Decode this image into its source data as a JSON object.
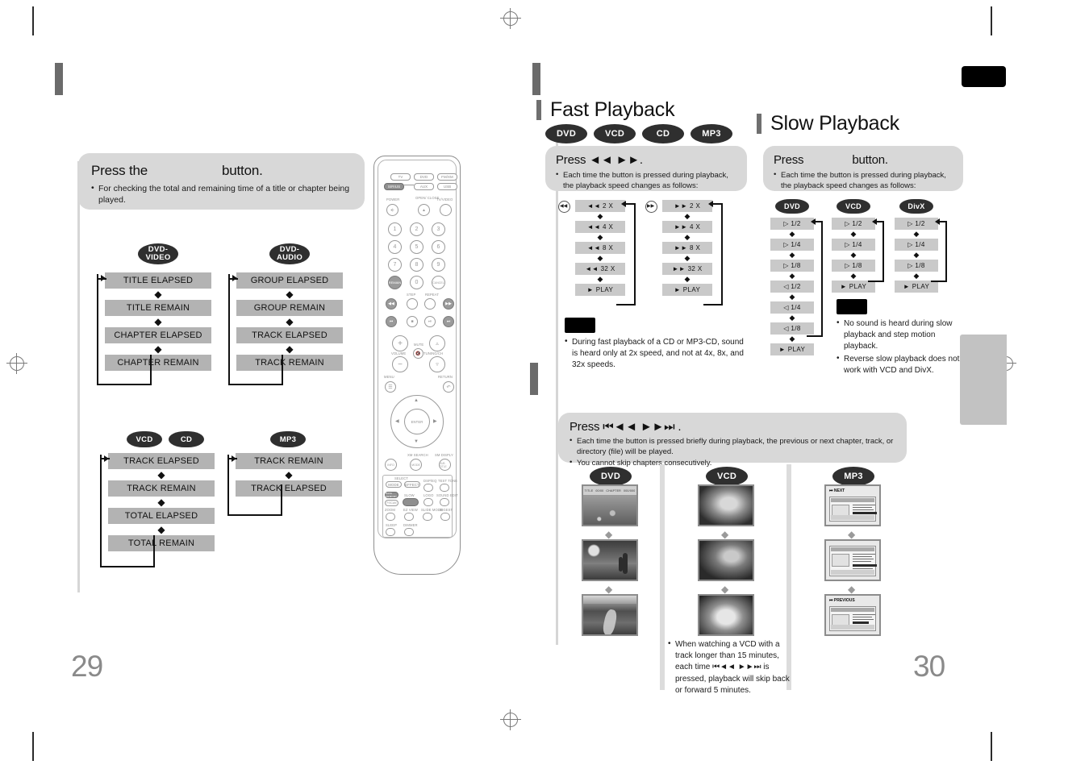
{
  "spread": {
    "left_page_number": "29",
    "right_page_number": "30"
  },
  "left_page": {
    "instruction_panel": {
      "press_prefix": "Press the",
      "press_suffix": "button.",
      "bullets": [
        "For checking the total and remaining time of a title or chapter being played."
      ]
    },
    "flows": [
      {
        "id": "dvd-video",
        "pill_lines": [
          "DVD-",
          "VIDEO"
        ],
        "steps": [
          "TITLE ELAPSED",
          "TITLE REMAIN",
          "CHAPTER ELAPSED",
          "CHAPTER REMAIN"
        ]
      },
      {
        "id": "dvd-audio",
        "pill_lines": [
          "DVD-",
          "AUDIO"
        ],
        "steps": [
          "GROUP ELAPSED",
          "GROUP REMAIN",
          "TRACK ELAPSED",
          "TRACK REMAIN"
        ]
      },
      {
        "id": "vcd-cd",
        "pills": [
          "VCD",
          "CD"
        ],
        "steps": [
          "TRACK ELAPSED",
          "TRACK REMAIN",
          "TOTAL ELAPSED",
          "TOTAL REMAIN"
        ]
      },
      {
        "id": "mp3",
        "pills": [
          "MP3"
        ],
        "steps": [
          "TRACK REMAIN",
          "TRACK ELAPSED"
        ]
      }
    ]
  },
  "fast_playback": {
    "title": "Fast Playback",
    "pills": [
      "DVD",
      "VCD",
      "CD",
      "MP3"
    ],
    "press": "Press ◄◄ ►►.",
    "bullets": [
      "Each time the button is pressed during playback, the playback speed changes as follows:"
    ],
    "columns": [
      {
        "key_icon": "◄◄",
        "steps": [
          "◄◄  2 X",
          "◄◄  4 X",
          "◄◄  8 X",
          "◄◄  32 X",
          "►  PLAY"
        ]
      },
      {
        "key_icon": "►►",
        "steps": [
          "►►  2 X",
          "►►  4 X",
          "►►  8 X",
          "►►  32 X",
          "►  PLAY"
        ]
      }
    ],
    "notes": [
      "During fast playback of a CD or MP3-CD, sound is heard only at 2x speed, and not at 4x, 8x, and 32x speeds."
    ]
  },
  "slow_playback": {
    "title": "Slow Playback",
    "press_prefix": "Press",
    "press_suffix": "button.",
    "bullets": [
      "Each time the button is pressed during playback, the playback speed changes as follows:"
    ],
    "columns": [
      {
        "pill": "DVD",
        "steps": [
          "▷  1/2",
          "▷  1/4",
          "▷  1/8",
          "◁  1/2",
          "◁  1/4",
          "◁  1/8",
          "►  PLAY"
        ]
      },
      {
        "pill": "VCD",
        "steps": [
          "▷  1/2",
          "▷  1/4",
          "▷  1/8",
          "►  PLAY"
        ]
      },
      {
        "pill": "DivX",
        "steps": [
          "▷  1/2",
          "▷  1/4",
          "▷  1/8",
          "►  PLAY"
        ]
      }
    ],
    "notes": [
      "No sound is heard during slow playback and step motion playback.",
      "Reverse slow playback does not work with VCD and DivX."
    ]
  },
  "skip_playback": {
    "press": "Press  ⏮◄◄ ►►⏭ .",
    "bullets": [
      "Each time the button is pressed briefly during playback, the previous or next chapter, track, or directory (file) will be played.",
      "You cannot skip chapters consecutively."
    ],
    "columns": [
      {
        "pill": "DVD",
        "shots": [
          "osd-title-chapter",
          "desert-cactus",
          "river-valley"
        ]
      },
      {
        "pill": "VCD",
        "shots": [
          "chipmunk",
          "lion-cub",
          "raccoon"
        ]
      },
      {
        "pill": "MP3",
        "shots": [
          "mp3-next-menu",
          "mp3-mid-menu",
          "mp3-previous-menu"
        ]
      }
    ],
    "mp3_shot_labels": [
      "⏮ NEXT",
      "",
      "⏮ PREVIOUS"
    ],
    "dvd_osd_fields": [
      "TITLE",
      "00/00",
      "CHAPTER",
      "000/000"
    ],
    "notes": [
      "When watching a VCD with a track longer than 15 minutes, each time ⏮◄◄ ►►⏭ is pressed, playback will skip back or forward 5 minutes."
    ]
  },
  "remote": {
    "source_buttons": [
      "TV",
      "DVD",
      "FM/XM",
      "SIRIUS",
      "AUX",
      "USB"
    ],
    "labels": {
      "power": "POWER",
      "open_close": "OPEN/ CLOSE",
      "tv_video": "TV/VIDEO",
      "step": "STEP",
      "repeat": "REPEAT",
      "mute": "MUTE",
      "volume": "VOLUME",
      "tuning": "TUNING/CH",
      "menu": "MENU",
      "return": "RETURN",
      "enter": "ENTER",
      "search": "XM SEARCH",
      "display": "SM DISPLY",
      "info": "INFO",
      "mode": "MODE",
      "effect": "EFFECT",
      "dsp_eq": "DSP/EQ",
      "test_tone": "TEST TONE",
      "data_memory": "DATA MEMORY",
      "p_scan": "P.SCAN",
      "slow": "SLOW",
      "logo": "LOGO",
      "sound_edit": "SOUND EDIT",
      "zoom": "ZOOM",
      "ez_view": "EZ VIEW",
      "subtitle": "SUB TITLE",
      "slide_mode": "SLIDE MODE",
      "digest": "DIGEST",
      "sleep": "SLEEP",
      "dimmer": "DIMMER",
      "cancel": "CANCEL",
      "remain": "REMAIN"
    },
    "highlighted_button": "SLOW"
  }
}
